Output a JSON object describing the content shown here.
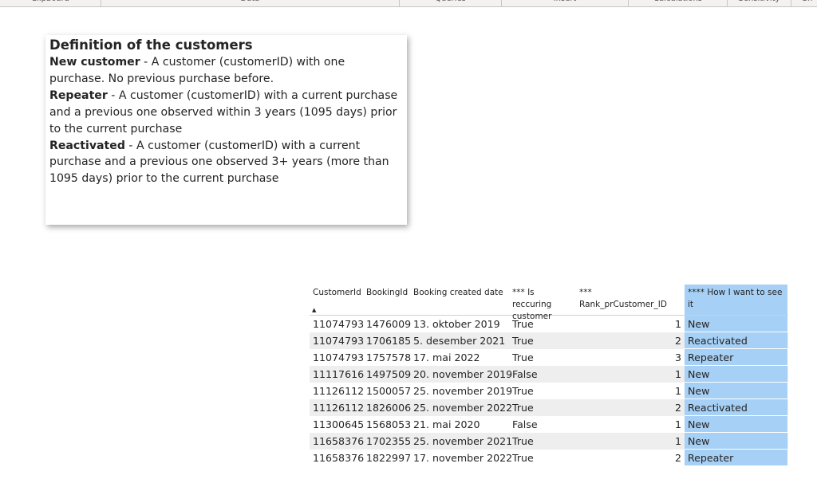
{
  "ribbon": {
    "groups": [
      "Clipboard",
      "Data",
      "Queries",
      "Insert",
      "Calculations",
      "Sensitivity",
      "Sh"
    ]
  },
  "definition_card": {
    "title": "Definition of the customers",
    "items": [
      {
        "term": "New customer",
        "text": " - A customer (customerID) with one purchase. No previous purchase before."
      },
      {
        "term": "Repeater",
        "text": " - A customer (customerID) with a current purchase and a previous one observed within 3 years (1095 days) prior to the current purchase"
      },
      {
        "term": "Reactivated",
        "text": " - A customer (customerID) with a current purchase and a previous one observed 3+ years (more than 1095 days) prior to the current purchase"
      }
    ]
  },
  "table": {
    "highlight_color": "#a6d0f5",
    "headers": [
      {
        "label": "CustomerId"
      },
      {
        "label": "BookingId"
      },
      {
        "label": "Booking created date"
      },
      {
        "label": "*** Is reccuring customer"
      },
      {
        "label": "*** Rank_prCustomer_ID"
      },
      {
        "label": "**** How I want to see it"
      }
    ],
    "sort_indicator": "▲",
    "rows": [
      [
        "11074793",
        "1476009",
        "13. oktober 2019",
        "True",
        "1",
        "New"
      ],
      [
        "11074793",
        "1706185",
        "5. desember 2021",
        "True",
        "2",
        "Reactivated"
      ],
      [
        "11074793",
        "1757578",
        "17. mai 2022",
        "True",
        "3",
        "Repeater"
      ],
      [
        "11117616",
        "1497509",
        "20. november 2019",
        "False",
        "1",
        "New"
      ],
      [
        "11126112",
        "1500057",
        "25. november 2019",
        "True",
        "1",
        "New"
      ],
      [
        "11126112",
        "1826006",
        "25. november 2022",
        "True",
        "2",
        "Reactivated"
      ],
      [
        "11300645",
        "1568053",
        "21. mai 2020",
        "False",
        "1",
        "New"
      ],
      [
        "11658376",
        "1702355",
        "25. november 2021",
        "True",
        "1",
        "New"
      ],
      [
        "11658376",
        "1822997",
        "17. november 2022",
        "True",
        "2",
        "Repeater"
      ]
    ]
  }
}
